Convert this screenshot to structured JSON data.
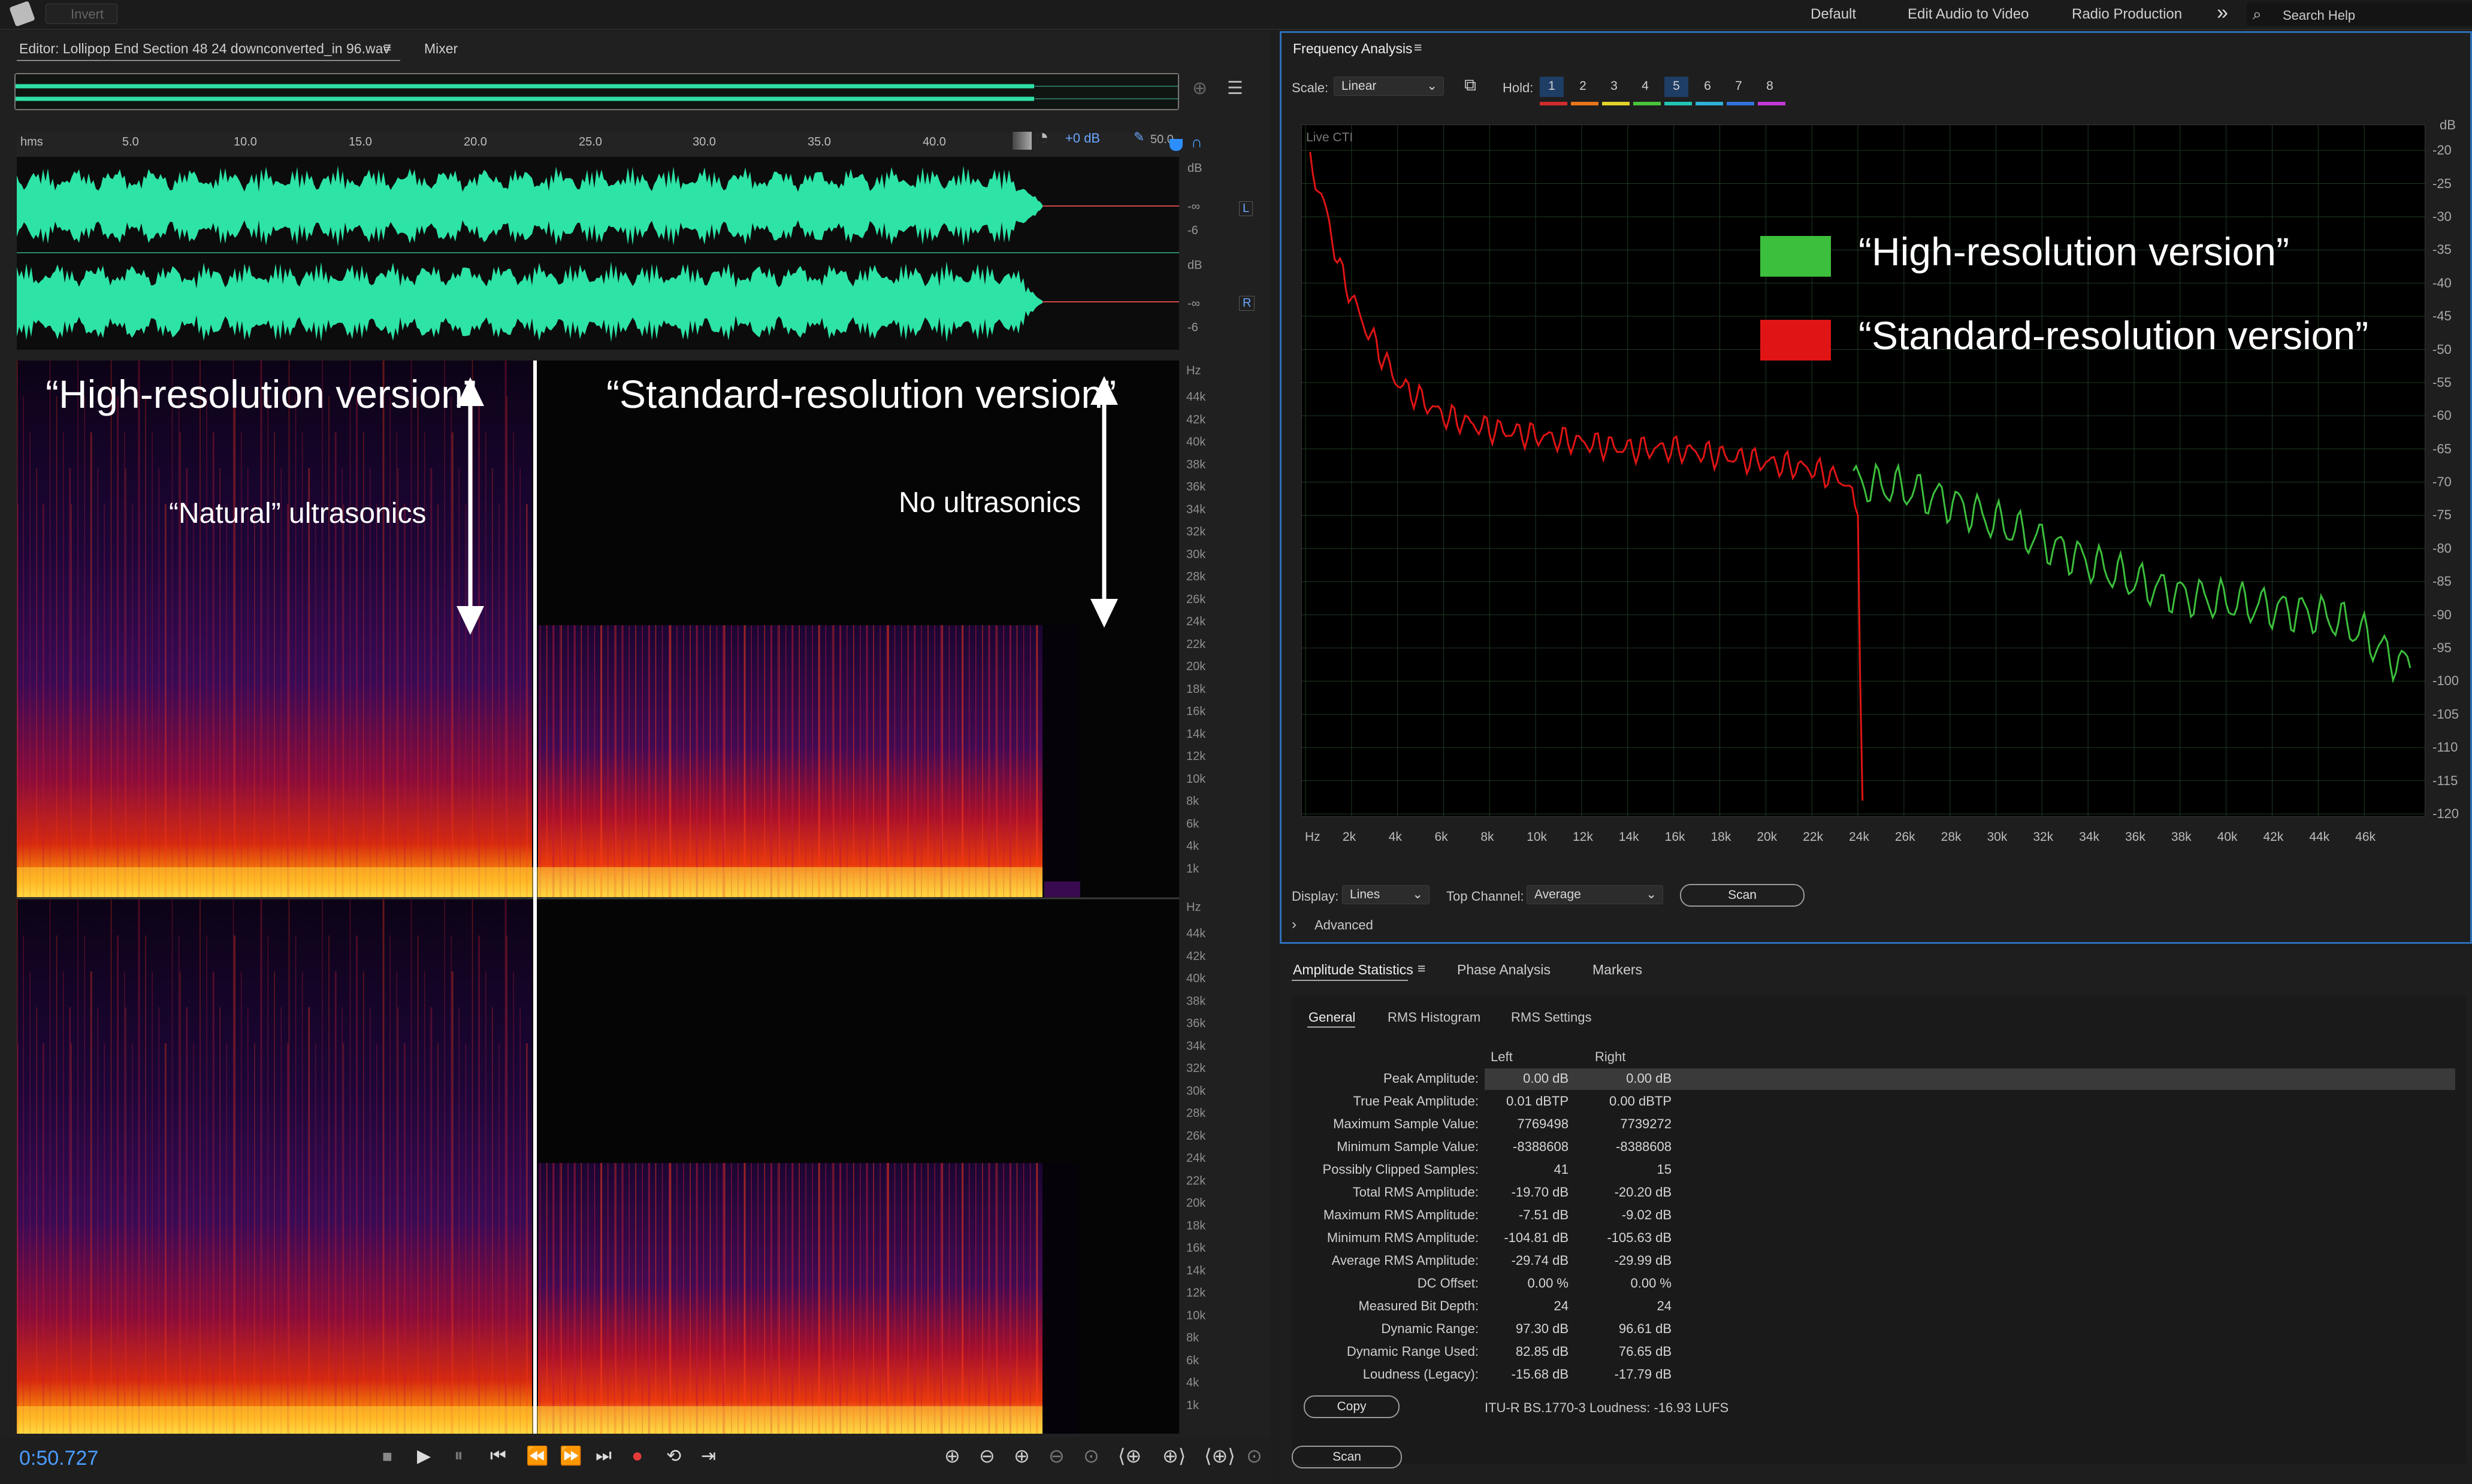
{
  "topbar": {
    "invert_label": "Invert",
    "workspaces": [
      "Default",
      "Edit Audio to Video",
      "Radio Production"
    ],
    "more": "»",
    "search_placeholder": "Search Help"
  },
  "editor": {
    "tab_title": "Editor: Lollipop End Section 48 24 downconverted_in 96.wav",
    "tab_menu": "≡",
    "mixer_tab": "Mixer",
    "gain": "+0 dB",
    "zoom_value": "50.0",
    "ruler_unit": "hms",
    "ruler_ticks": [
      "5.0",
      "10.0",
      "15.0",
      "20.0",
      "25.0",
      "30.0",
      "35.0",
      "40.0"
    ],
    "db_labels": {
      "unit": "dB",
      "inf": "-∞",
      "m6": "-6"
    },
    "channels": [
      "L",
      "R"
    ],
    "hz_unit": "Hz",
    "hz_ticks": [
      "44k",
      "42k",
      "40k",
      "38k",
      "36k",
      "34k",
      "32k",
      "30k",
      "28k",
      "26k",
      "24k",
      "22k",
      "20k",
      "18k",
      "16k",
      "14k",
      "12k",
      "10k",
      "8k",
      "6k",
      "4k",
      "1k"
    ],
    "time_display": "0:50.727"
  },
  "overlay": {
    "high_res": "“High-resolution version”",
    "std_res": "“Standard-resolution version”",
    "natural": "“Natural” ultrasonics",
    "no_ultra": "No ultrasonics"
  },
  "freq": {
    "title": "Frequency Analysis",
    "menu": "≡",
    "scale_label": "Scale:",
    "scale_value": "Linear",
    "hold_label": "Hold:",
    "holds": [
      {
        "n": "1",
        "color": "#d22b2b"
      },
      {
        "n": "2",
        "color": "#e8761c"
      },
      {
        "n": "3",
        "color": "#e3d22a"
      },
      {
        "n": "4",
        "color": "#49c43b"
      },
      {
        "n": "5",
        "color": "#22c6b4"
      },
      {
        "n": "6",
        "color": "#2fb1d8"
      },
      {
        "n": "7",
        "color": "#3272d8"
      },
      {
        "n": "8",
        "color": "#c23ad6"
      }
    ],
    "live": "Live CTI",
    "legend": [
      {
        "label": "“High-resolution version”",
        "color": "#3cbf3c"
      },
      {
        "label": "“Standard-resolution version”",
        "color": "#e01414"
      }
    ],
    "db_unit": "dB",
    "db_ticks": [
      "-20",
      "-25",
      "-30",
      "-35",
      "-40",
      "-45",
      "-50",
      "-55",
      "-60",
      "-65",
      "-70",
      "-75",
      "-80",
      "-85",
      "-90",
      "-95",
      "-100",
      "-105",
      "-110",
      "-115",
      "-120"
    ],
    "hz_ticks": [
      "Hz",
      "2k",
      "4k",
      "6k",
      "8k",
      "10k",
      "12k",
      "14k",
      "16k",
      "18k",
      "20k",
      "22k",
      "24k",
      "26k",
      "28k",
      "30k",
      "32k",
      "34k",
      "36k",
      "38k",
      "40k",
      "42k",
      "44k",
      "46k"
    ],
    "display_label": "Display:",
    "display_value": "Lines",
    "top_channel_label": "Top Channel:",
    "top_channel_value": "Average",
    "scan": "Scan",
    "advanced": "Advanced"
  },
  "chart_data": {
    "type": "line",
    "xlabel": "Hz",
    "ylabel": "dB",
    "xlim": [
      0,
      48000
    ],
    "ylim": [
      -120,
      -18
    ],
    "series": [
      {
        "name": "“Standard-resolution version”",
        "color": "#e01414",
        "x": [
          200,
          800,
          1500,
          2500,
          4000,
          6000,
          8000,
          10000,
          12000,
          14000,
          16000,
          18000,
          20000,
          22000,
          23500,
          24000,
          24100,
          24200
        ],
        "y": [
          -22,
          -28,
          -38,
          -46,
          -55,
          -60,
          -62,
          -63,
          -64,
          -65,
          -65,
          -66,
          -67,
          -68,
          -70,
          -75,
          -100,
          -118
        ]
      },
      {
        "name": "“High-resolution version”",
        "color": "#3cbf3c",
        "x": [
          23800,
          26000,
          28000,
          30000,
          32000,
          34000,
          36000,
          38000,
          40000,
          42000,
          44000,
          45000,
          46000,
          47000,
          48000
        ],
        "y": [
          -70,
          -71,
          -73,
          -76,
          -79,
          -82,
          -85,
          -87,
          -88,
          -89,
          -90,
          -91,
          -93,
          -96,
          -98
        ]
      }
    ]
  },
  "amp": {
    "tabs": [
      "Amplitude Statistics",
      "Phase Analysis",
      "Markers"
    ],
    "menu": "≡",
    "subtabs": [
      "General",
      "RMS Histogram",
      "RMS Settings"
    ],
    "col_left": "Left",
    "col_right": "Right",
    "rows": [
      {
        "label": "Peak Amplitude:",
        "left": "0.00 dB",
        "right": "0.00 dB"
      },
      {
        "label": "True Peak Amplitude:",
        "left": "0.01 dBTP",
        "right": "0.00 dBTP"
      },
      {
        "label": "Maximum Sample Value:",
        "left": "7769498",
        "right": "7739272"
      },
      {
        "label": "Minimum Sample Value:",
        "left": "-8388608",
        "right": "-8388608"
      },
      {
        "label": "Possibly Clipped Samples:",
        "left": "41",
        "right": "15"
      },
      {
        "label": "Total RMS Amplitude:",
        "left": "-19.70 dB",
        "right": "-20.20 dB"
      },
      {
        "label": "Maximum RMS Amplitude:",
        "left": "-7.51 dB",
        "right": "-9.02 dB"
      },
      {
        "label": "Minimum RMS Amplitude:",
        "left": "-104.81 dB",
        "right": "-105.63 dB"
      },
      {
        "label": "Average RMS Amplitude:",
        "left": "-29.74 dB",
        "right": "-29.99 dB"
      },
      {
        "label": "DC Offset:",
        "left": "0.00 %",
        "right": "0.00 %"
      },
      {
        "label": "Measured Bit Depth:",
        "left": "24",
        "right": "24"
      },
      {
        "label": "Dynamic Range:",
        "left": "97.30 dB",
        "right": "96.61 dB"
      },
      {
        "label": "Dynamic Range Used:",
        "left": "82.85 dB",
        "right": "76.65 dB"
      },
      {
        "label": "Loudness (Legacy):",
        "left": "-15.68 dB",
        "right": "-17.79 dB"
      }
    ],
    "copy": "Copy",
    "loudness": "ITU-R BS.1770-3 Loudness:  -16.93 LUFS",
    "scan": "Scan"
  }
}
